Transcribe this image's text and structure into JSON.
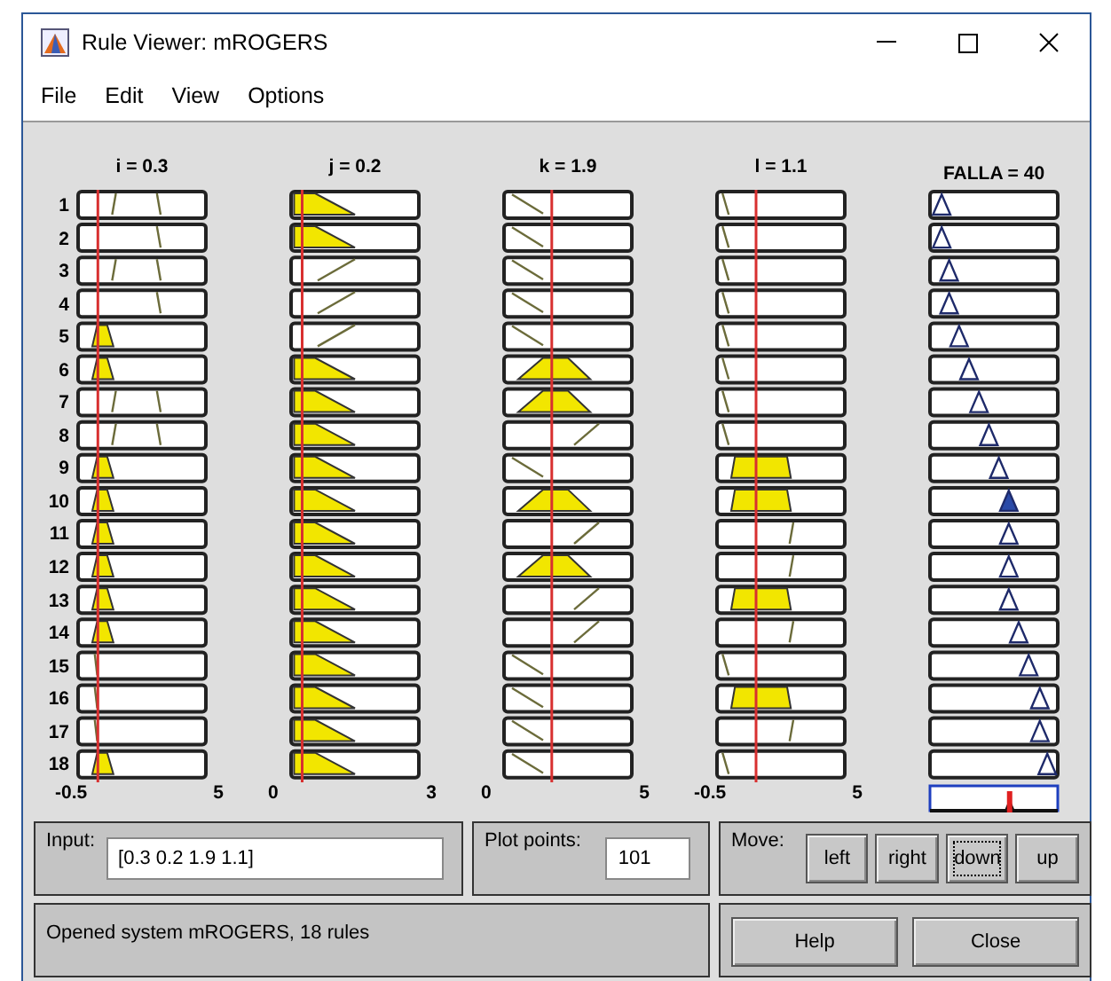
{
  "window": {
    "title": "Rule Viewer: mROGERS"
  },
  "menu": [
    "File",
    "Edit",
    "View",
    "Options"
  ],
  "variables": [
    {
      "kind": "input",
      "label": "i = 0.3",
      "min": "-0.5",
      "max": "5"
    },
    {
      "kind": "input",
      "label": "j = 0.2",
      "min": "0",
      "max": "3"
    },
    {
      "kind": "input",
      "label": "k = 1.9",
      "min": "0",
      "max": "5"
    },
    {
      "kind": "input",
      "label": "l = 1.1",
      "min": "-0.5",
      "max": "5"
    },
    {
      "kind": "output",
      "label": "FALLA = 40"
    }
  ],
  "rules": [
    "1",
    "2",
    "3",
    "4",
    "5",
    "6",
    "7",
    "8",
    "9",
    "10",
    "11",
    "12",
    "13",
    "14",
    "15",
    "16",
    "17",
    "18"
  ],
  "input": {
    "label": "Input:",
    "value": "[0.3 0.2 1.9 1.1]"
  },
  "plot_points": {
    "label": "Plot points:",
    "value": "101"
  },
  "move": {
    "label": "Move:",
    "buttons": [
      {
        "label": "left",
        "focused": false
      },
      {
        "label": "right",
        "focused": false
      },
      {
        "label": "down",
        "focused": true
      },
      {
        "label": "up",
        "focused": false
      }
    ]
  },
  "status": "Opened system mROGERS, 18 rules",
  "buttons": [
    "Help",
    "Close"
  ]
}
